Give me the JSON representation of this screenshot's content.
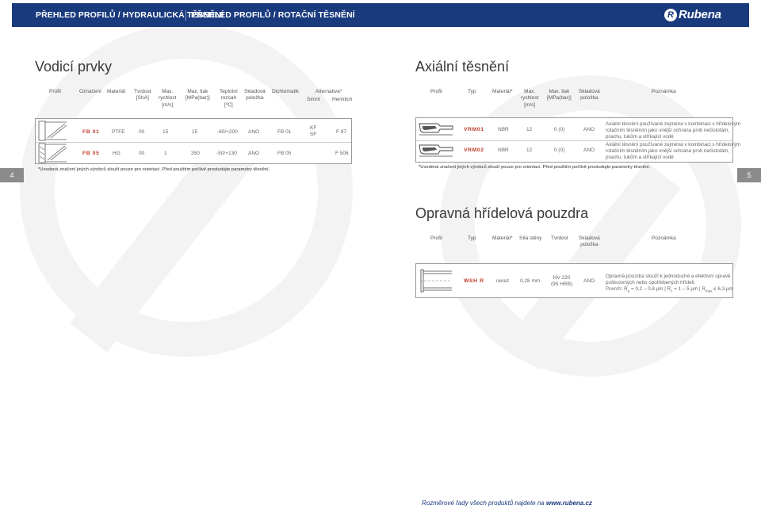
{
  "header": {
    "section_hydraulic": "PŘEHLED PROFILŮ / HYDRAULICKÁ TĚSNĚNÍ",
    "section_rotary": "PŘEHLED PROFILŮ / ROTAČNÍ TĚSNĚNÍ",
    "logo_text": "Rubena",
    "logo_mark": "R",
    "brand_color": "#1a3a7e"
  },
  "left": {
    "title": "Vodicí prvky",
    "columns": {
      "profil": "Profil",
      "oznaceni": "Označení",
      "material": "Materiál",
      "tvrdost_1": "Tvrdost",
      "tvrdost_2": "[ShA]",
      "rychlost_1": "Max.",
      "rychlost_2": "rychlost",
      "rychlost_3": "[m/s]",
      "tlak_1": "Max. tlak",
      "tlak_2": "[MPa(bar)]",
      "teplota_1": "Teplotní",
      "teplota_2": "rozsah",
      "teplota_3": "[ºC]",
      "skladova_1": "Skladová",
      "skladova_2": "položka",
      "dichtomatik": "Dichtomatik",
      "alternativa": "Alternativa*",
      "simrit": "Simrit",
      "hennlich": "Hennlich"
    },
    "rows": [
      {
        "code": "FB 01",
        "material": "PTFE",
        "tvrdost": "00",
        "rychlost": "15",
        "tlak": "15",
        "teplota": "-60/+200",
        "skladova": "ANO",
        "dichtomatik": "FB 01",
        "simrit_1": "KF",
        "simrit_2": "SF",
        "hennlich": "F 87"
      },
      {
        "code": "FB 05",
        "material": "HG",
        "tvrdost": "00",
        "rychlost": "1",
        "tlak": "350",
        "teplota": "-50/+130",
        "skladova": "ANO",
        "dichtomatik": "FB 05",
        "simrit_1": "",
        "simrit_2": "",
        "hennlich": "F 506"
      }
    ],
    "footnote": "*Uvedená značení jiných výrobců slouží pouze pro orientaci. Před použitím pečlivě prostudujte parametry těsnění.",
    "page_number": "4"
  },
  "axial": {
    "title": "Axiální těsnění",
    "columns": {
      "profil": "Profil",
      "typ": "Typ",
      "material": "Materiál*",
      "rychlost_1": "Max.",
      "rychlost_2": "rychlost",
      "rychlost_3": "[m/s]",
      "tlak_1": "Max. tlak",
      "tlak_2": "[MPa(bar)]",
      "skladova_1": "Skladová",
      "skladova_2": "položka",
      "poznamka": "Poznámka"
    },
    "rows": [
      {
        "code": "VRM01",
        "material": "NBR",
        "rychlost": "12",
        "tlak": "0 (0)",
        "skladova": "ANO",
        "note_1": "Axiální těsnění používané zejména v kombinaci s hřídelovým",
        "note_2": "rotačním těsněním jako vnější ochrana proti nečistotám,",
        "note_3": "prachu, tukům a stříkající vodě"
      },
      {
        "code": "VRM02",
        "material": "NBR",
        "rychlost": "12",
        "tlak": "0 (0)",
        "skladova": "ANO",
        "note_1": "Axiální těsnění používané zejména v kombinaci s hřídelovým",
        "note_2": "rotačním těsněním jako vnější ochrana proti nečistotám,",
        "note_3": "prachu, tukům a stříkající vodě"
      }
    ],
    "footnote": "*Uvedená značení jiných výrobců slouží pouze pro orientaci. Před použitím pečlivě prostudujte parametry těsnění.",
    "page_number": "5"
  },
  "sleeve": {
    "title": "Opravná hřídelová pouzdra",
    "columns": {
      "profil": "Profil",
      "typ": "Typ",
      "material": "Materiál*",
      "sila": "Síla stěny",
      "tvrdost": "Tvrdost",
      "skladova_1": "Skladová",
      "skladova_2": "položka",
      "poznamka": "Poznámka"
    },
    "row": {
      "code": "WSH R",
      "material": "nerez",
      "sila": "0,28 mm",
      "tvrdost_1": "HV 220",
      "tvrdost_2": "(95 HRB)",
      "skladova": "ANO",
      "note_1": "Opravná pouzdra slouží k jednoduché a efektivní opravě",
      "note_2": "poškozených nebo opotřebených hřídelí.",
      "note_3_a": "Povrch: R",
      "note_3_sub1": "a",
      "note_3_b": " = 0,2 – 0,8 µm | R",
      "note_3_sub2": "z",
      "note_3_c": " = 1 – 5 µm | R",
      "note_3_sub3": "max",
      "note_3_d": " ≤ 6,3 µm"
    }
  },
  "bottom_note": {
    "text": "Rozměrové řady všech produktů najdete na ",
    "link": "www.rubena.cz"
  },
  "colors": {
    "accent_red": "#c0392b",
    "header_blue": "#1a3a7e",
    "tab_gray": "#8b8b8b"
  }
}
